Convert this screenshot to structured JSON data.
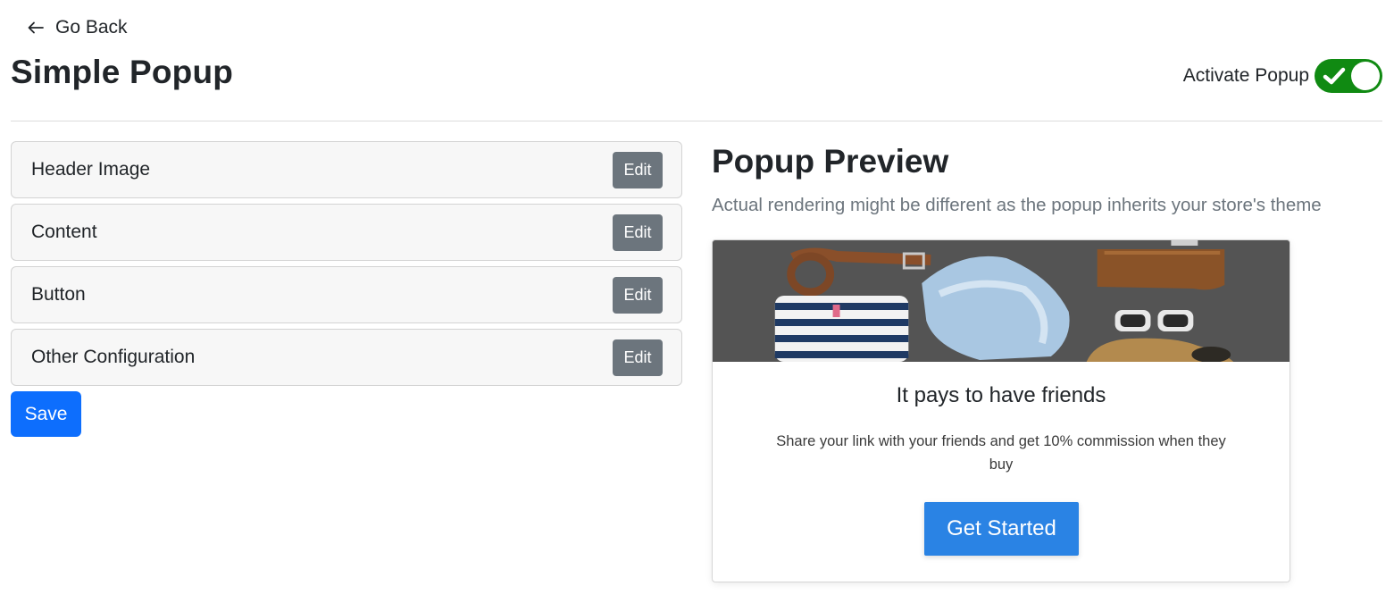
{
  "nav": {
    "go_back": "Go Back"
  },
  "page": {
    "title": "Simple Popup"
  },
  "activation": {
    "label": "Activate Popup",
    "enabled": true,
    "accent_color": "#108a12"
  },
  "sections": [
    {
      "label": "Header Image",
      "edit": "Edit"
    },
    {
      "label": "Content",
      "edit": "Edit"
    },
    {
      "label": "Button",
      "edit": "Edit"
    },
    {
      "label": "Other Configuration",
      "edit": "Edit"
    }
  ],
  "save_label": "Save",
  "preview": {
    "title": "Popup Preview",
    "subtitle": "Actual rendering might be different as the popup inherits your store's theme",
    "popup": {
      "heading": "It pays to have friends",
      "text": "Share your link with your friends and get 10% commission when they buy",
      "button": "Get Started",
      "button_color": "#2a83e4"
    }
  },
  "colors": {
    "primary": "#0d6efd",
    "secondary": "#6c757d"
  }
}
